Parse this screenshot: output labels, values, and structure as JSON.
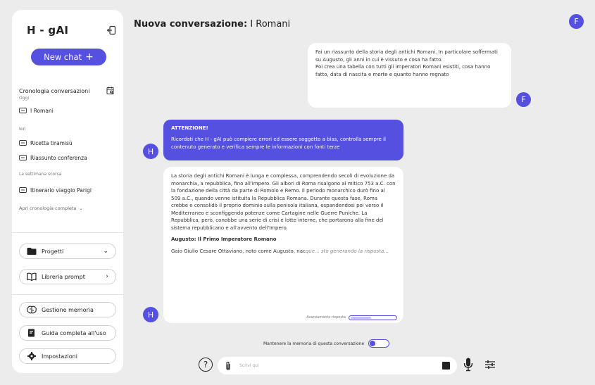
{
  "sidebar": {
    "brand": "H - gAI",
    "new_chat_label": "New chat",
    "history_title": "Cronologia conversazioni",
    "groups": [
      {
        "label": "Oggi",
        "items": [
          "I Romani"
        ]
      },
      {
        "label": "Ieri",
        "items": [
          "Ricetta tiramisù",
          "Riassunto conferenza"
        ]
      },
      {
        "label": "La settimana scorsa",
        "items": [
          "Itinerario viaggio Parigi"
        ]
      }
    ],
    "open_history": "Apri cronologia completa",
    "projects": "Progetti",
    "prompt_library": "Libreria prompt",
    "memory_mgmt": "Gestione memoria",
    "guide": "Guida completa all'uso",
    "settings": "Impostazioni"
  },
  "header": {
    "title_prefix": "Nuova conversazione:",
    "title_topic": "I Romani",
    "user_initial": "F"
  },
  "messages": {
    "user_text": "Fai un riassunto della storia degli antichi Romani. In particolare soffermati su Augusto, gli anni in cui è vissuto e cosa ha fatto.",
    "user_text_2": "Poi crea una tabella con tutti gli imperatori Romani esistiti, cosa hanno fatto, data di nascita e morte e quanto hanno regnato",
    "user_initial": "F",
    "bot_initial": "H",
    "warning_title": "ATTENZIONE!",
    "warning_text": "Ricordati che H - gAI può compiere errori ed essere soggetto a bias, controlla sempre il contenuto generato e verifica sempre le informazioni con fonti terze",
    "reply_p1": "La storia degli antichi Romani è lunga e complessa, comprendendo secoli di evoluzione da monarchia, a repubblica, fino all'impero. Gli albori di Roma risalgono al mitico 753 a.C. con la fondazione della città da parte di Romolo e Remo. Il periodo monarchico durò fino al 509 a.C., quando venne istituita la Repubblica Romana. Durante questa fase, Roma crebbe e consolidò il proprio dominio sulla penisola italiana, espandendosi poi verso il Mediterraneo e sconfiggendo potenze come Cartagine nelle Guerre Puniche. La Repubblica, però, conobbe una serie di crisi e lotte interne, che portarono alla fine del sistema repubblicano e all'avvento dell'Impero.",
    "reply_heading": "Augusto: Il Primo Imperatore Romano",
    "reply_p2": "Gaio Giulio Cesare Ottaviano, noto come Augusto, nac",
    "reply_generating": "que... sto generando la risposta...",
    "progress_label": "Avanzamento risposta",
    "progress_fraction": 0.45
  },
  "footer": {
    "memory_label": "Mantenere la memoria di questa conversazione",
    "input_placeholder": "Scrivi qui",
    "help_glyph": "?"
  },
  "colors": {
    "accent": "#5550e0",
    "background": "#ececec",
    "panel": "#ffffff"
  }
}
